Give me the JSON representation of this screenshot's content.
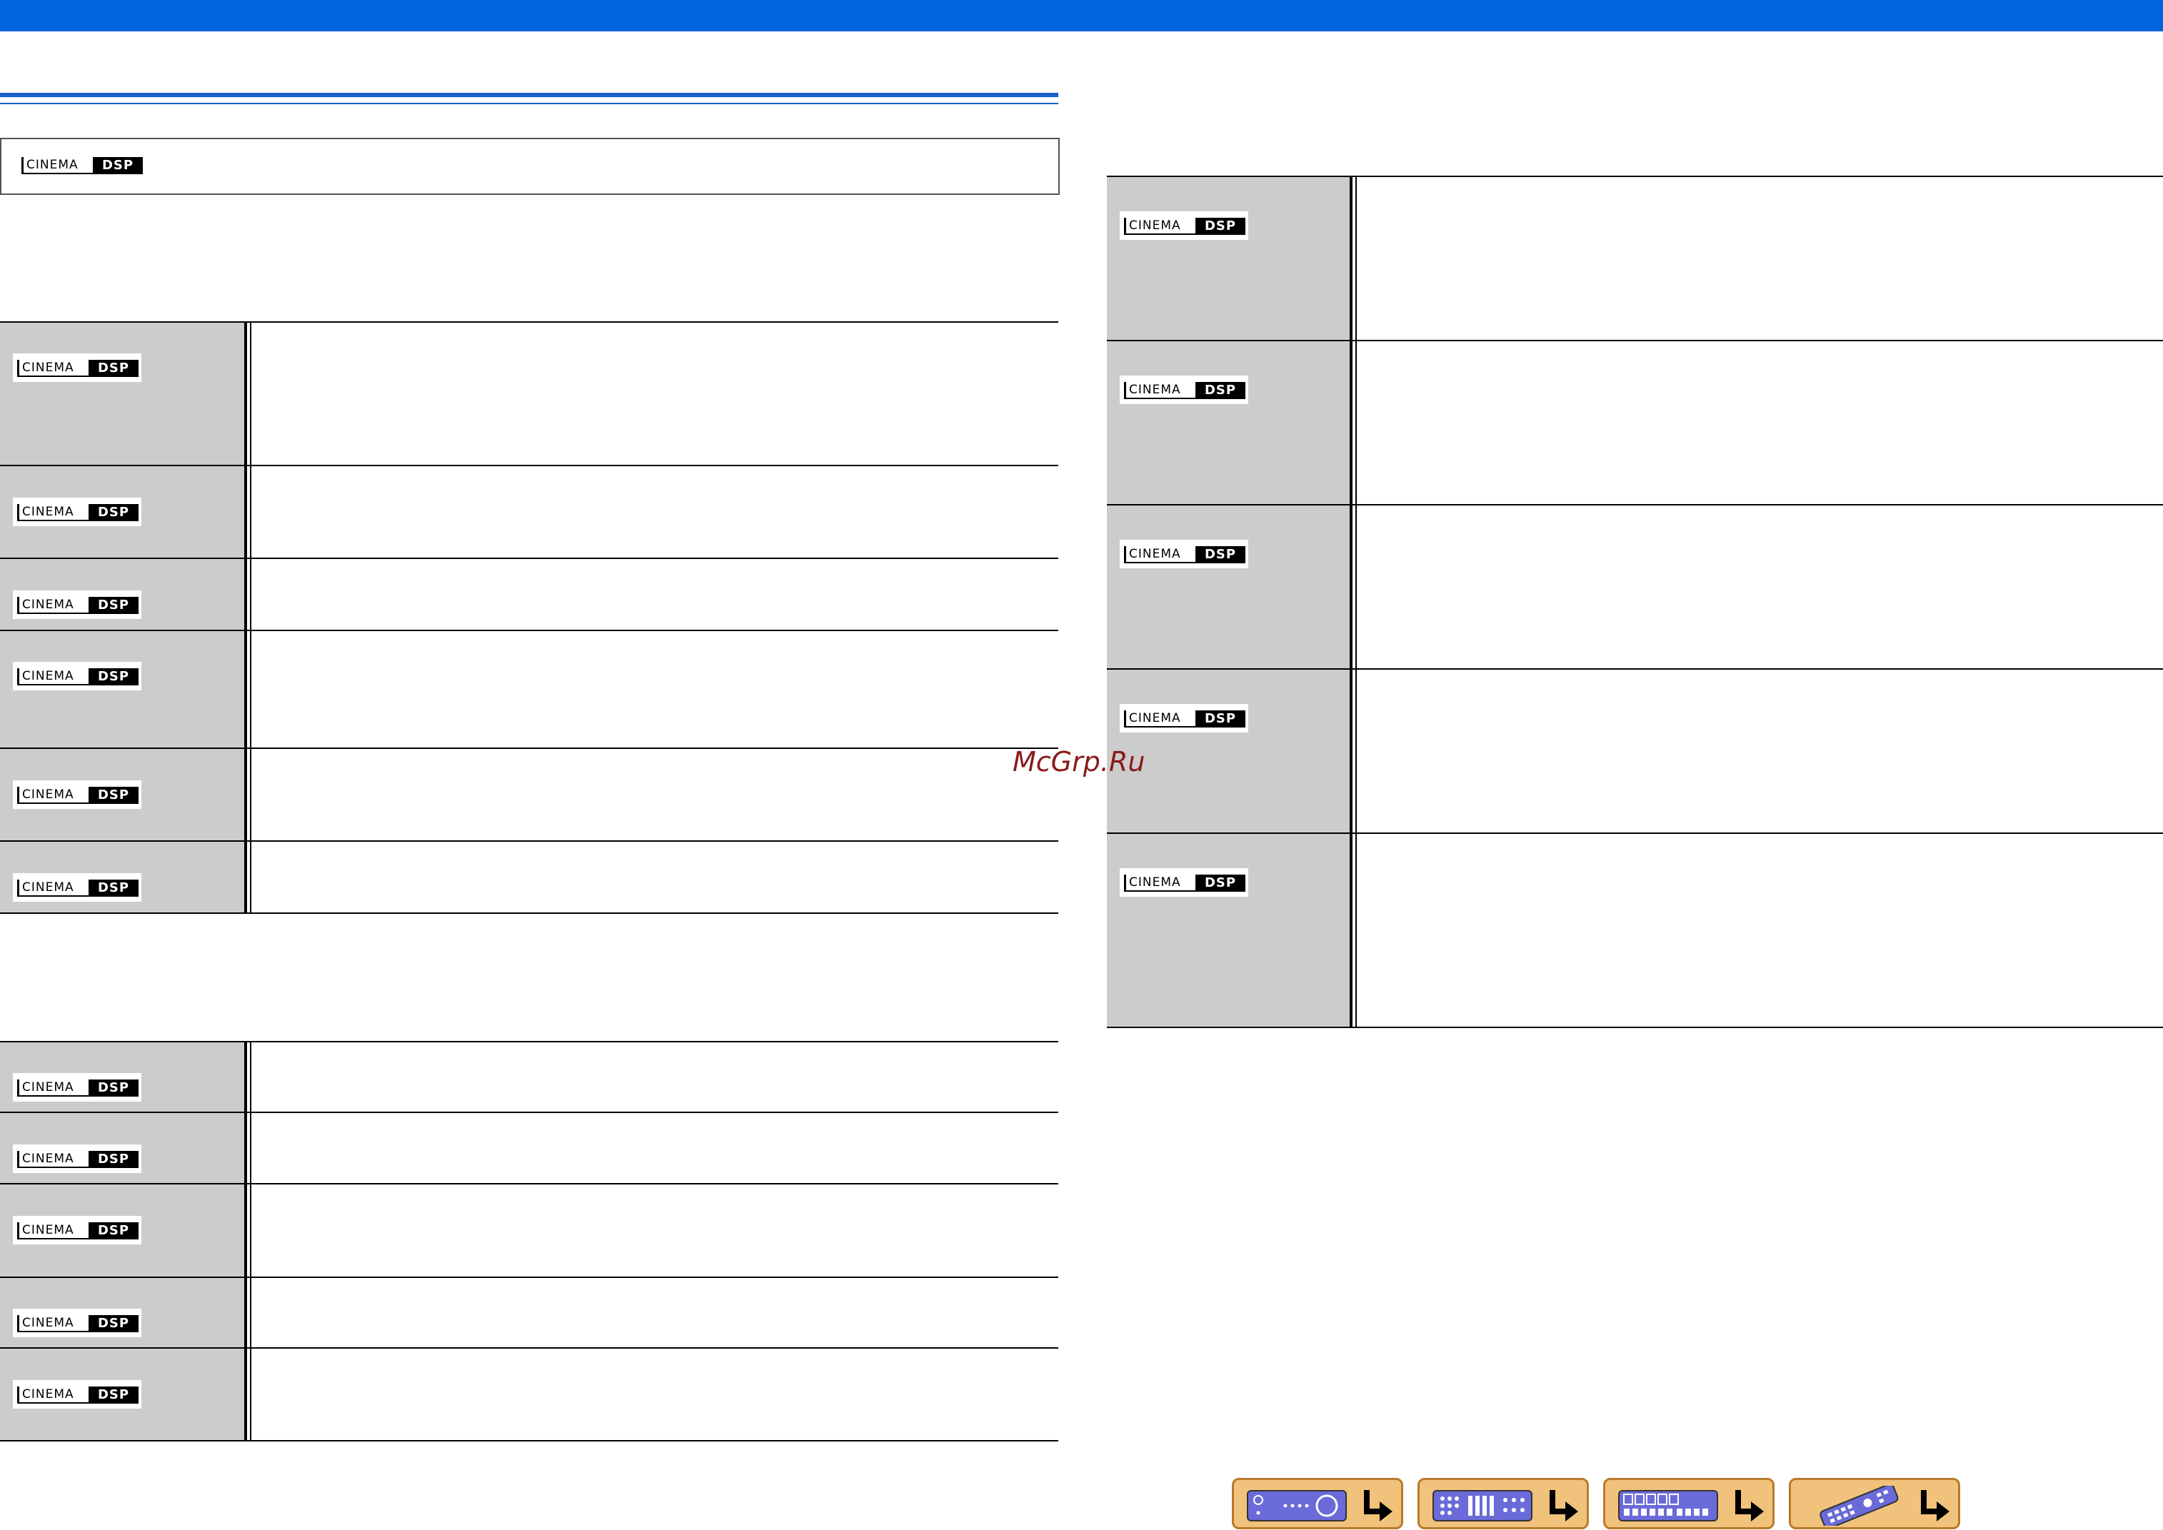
{
  "colors": {
    "top_bar": "#0066e0",
    "rule": "#1560c9",
    "label_cell": "#cccccc",
    "watermark": "#8b1a1a",
    "nav_button": "#f0c27b",
    "nav_button_border": "#b97a2a",
    "nav_device": "#6a6ad8"
  },
  "logo": {
    "cinema": "CINEMA",
    "dsp": "DSP"
  },
  "watermark": "McGrp.Ru",
  "nav_buttons": [
    {
      "icon": "front-panel-icon"
    },
    {
      "icon": "rear-panel-icon"
    },
    {
      "icon": "front-display-icon"
    },
    {
      "icon": "remote-control-icon"
    }
  ]
}
